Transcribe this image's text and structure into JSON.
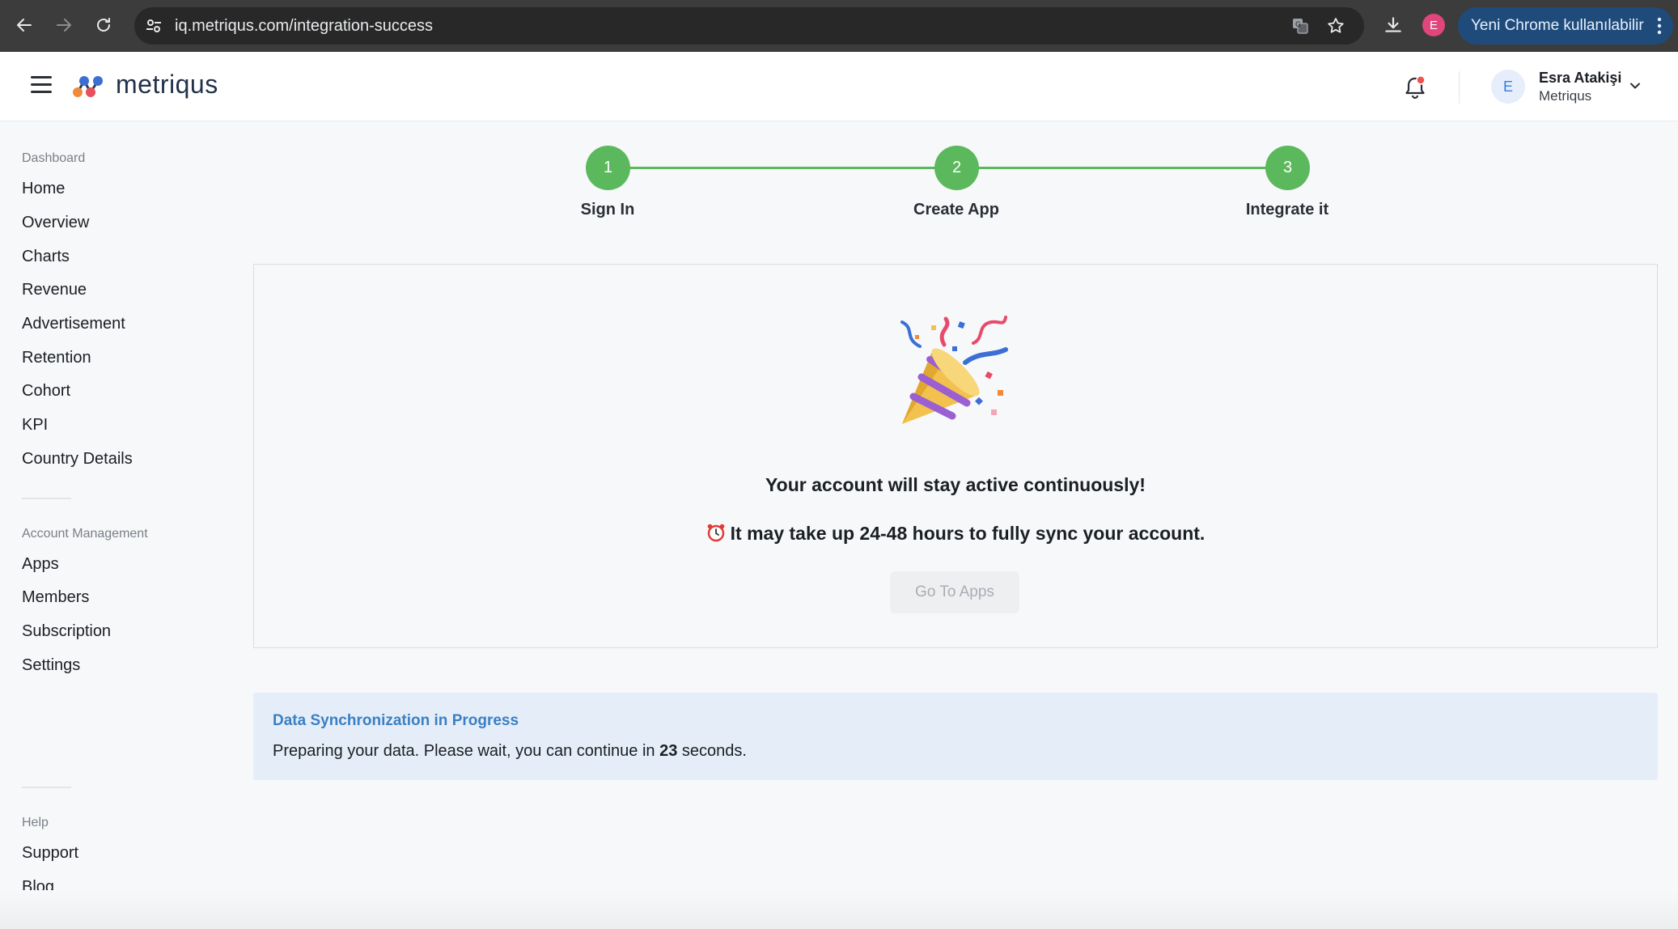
{
  "browser": {
    "url": "iq.metriqus.com/integration-success",
    "profile_initial": "E",
    "update_label": "Yeni Chrome kullanılabilir"
  },
  "header": {
    "logo_text": "metriqus",
    "user": {
      "initial": "E",
      "name": "Esra Atakişi",
      "org": "Metriqus"
    }
  },
  "sidebar": {
    "sections": [
      {
        "title": "Dashboard",
        "items": [
          "Home",
          "Overview",
          "Charts",
          "Revenue",
          "Advertisement",
          "Retention",
          "Cohort",
          "KPI",
          "Country Details"
        ]
      },
      {
        "title": "Account Management",
        "items": [
          "Apps",
          "Members",
          "Subscription",
          "Settings"
        ]
      },
      {
        "title": "Help",
        "items": [
          "Support",
          "Blog"
        ]
      }
    ]
  },
  "stepper": {
    "steps": [
      {
        "number": "1",
        "label": "Sign In"
      },
      {
        "number": "2",
        "label": "Create App"
      },
      {
        "number": "3",
        "label": "Integrate it"
      }
    ],
    "color": "#5cb85c"
  },
  "success_card": {
    "title": "Your account will stay active continuously!",
    "subtitle": "It may take up 24-48 hours to fully sync your account.",
    "button_label": "Go To Apps"
  },
  "sync_banner": {
    "title": "Data Synchronization in Progress",
    "text_before": "Preparing your data. Please wait, you can continue in ",
    "seconds": "23",
    "text_after": " seconds."
  },
  "colors": {
    "accent_blue": "#3b7fc4",
    "step_green": "#5cb85c"
  }
}
